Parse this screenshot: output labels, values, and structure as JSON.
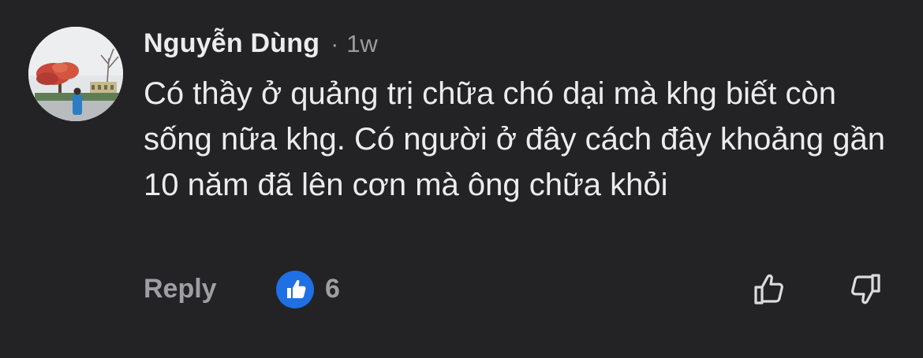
{
  "comment": {
    "author": "Nguyễn Dùng",
    "separator": "·",
    "time": "1w",
    "text": "Có thầy ở quảng trị chữa chó dại mà khg biết còn sống nữa khg. Có người ở đây cách đây khoảng gần 10 năm đã lên cơn mà ông chữa khỏi"
  },
  "actions": {
    "reply_label": "Reply",
    "like_count": "6",
    "like_badge_icon": "thumbs-up-icon",
    "upvote_icon": "thumbs-up-outline-icon",
    "downvote_icon": "thumbs-down-outline-icon"
  },
  "colors": {
    "background": "#232325",
    "text": "#ececee",
    "muted": "#9e9ea4",
    "like_badge": "#1f6fe5"
  }
}
